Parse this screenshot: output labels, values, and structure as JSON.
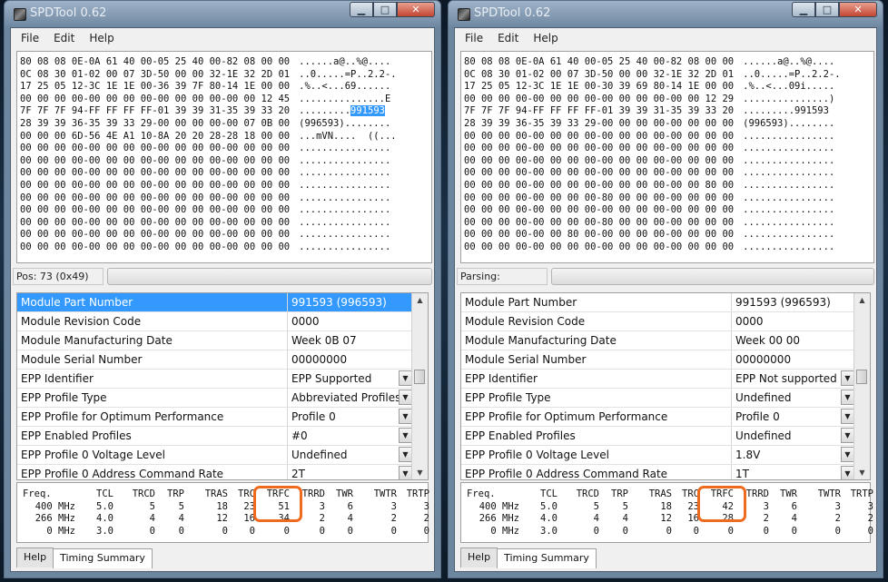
{
  "windows": [
    {
      "title": "SPDTool 0.62",
      "menu": [
        "File",
        "Edit",
        "Help"
      ],
      "hex_lines": [
        {
          "hex": "80 08 08 0E-0A 61 40 00-05 25 40 00-82 08 00 00",
          "ascii": "......a@..%@...."
        },
        {
          "hex": "0C 08 30 01-02 00 07 3D-50 00 00 32-1E 32 2D 01",
          "ascii": "..0.....=P..2.2-."
        },
        {
          "hex": "17 25 05 12-3C 1E 1E 00-36 39 7F 80-14 1E 00 00",
          "ascii": ".%..<...69......"
        },
        {
          "hex": "00 00 00 00-00 00 00 00-00 00 00 00-00 00 12 45",
          "ascii": "...............E"
        },
        {
          "hex": "7F 7F 7F 94-FF FF FF FF-01 39 39 31-35 39 33 20",
          "ascii": ".........",
          "sel": "991593"
        },
        {
          "hex": "28 39 39 36-35 39 33 29-00 00 00 00-00 07 0B 00",
          "ascii": "(996593)........"
        },
        {
          "hex": "00 00 00 6D-56 4E A1 10-8A 20 20 28-28 18 00 00",
          "ascii": "...mVN....  ((..."
        },
        {
          "hex": "00 00 00 00-00 00 00 00-00 00 00 00-00 00 00 00",
          "ascii": "................"
        },
        {
          "hex": "00 00 00 00-00 00 00 00-00 00 00 00-00 00 00 00",
          "ascii": "................"
        },
        {
          "hex": "00 00 00 00-00 00 00 00-00 00 00 00-00 00 00 00",
          "ascii": "................"
        },
        {
          "hex": "00 00 00 00-00 00 00 00-00 00 00 00-00 00 00 00",
          "ascii": "................"
        },
        {
          "hex": "00 00 00 00-00 00 00 00-00 00 00 00-00 00 00 00",
          "ascii": "................"
        },
        {
          "hex": "00 00 00 00-00 00 00 00-00 00 00 00-00 00 00 00",
          "ascii": "................"
        },
        {
          "hex": "00 00 00 00-00 00 00 00-00 00 00 00-00 00 00 00",
          "ascii": "................"
        },
        {
          "hex": "00 00 00 00-00 00 00 00-00 00 00 00-00 00 00 00",
          "ascii": "................"
        },
        {
          "hex": "00 00 00 00-00 00 00 00-00 00 00 00-00 00 00 00",
          "ascii": "................"
        }
      ],
      "status_label": "Pos: 73 (0x49)",
      "properties": [
        {
          "name": "Module Part Number",
          "value": "991593 (996593)",
          "selected": true
        },
        {
          "name": "Module Revision Code",
          "value": "0000"
        },
        {
          "name": "Module Manufacturing Date",
          "value": "Week 0B 07"
        },
        {
          "name": "Module Serial Number",
          "value": "00000000"
        },
        {
          "name": "EPP Identifier",
          "value": "EPP Supported",
          "dropdown": true
        },
        {
          "name": "EPP Profile Type",
          "value": "Abbreviated Profiles",
          "dropdown": true
        },
        {
          "name": "EPP Profile for Optimum Performance",
          "value": "Profile 0",
          "dropdown": true
        },
        {
          "name": "EPP Enabled Profiles",
          "value": "#0",
          "dropdown": true
        },
        {
          "name": "EPP Profile 0 Voltage Level",
          "value": "Undefined",
          "dropdown": true
        },
        {
          "name": "EPP Profile 0 Address Command Rate",
          "value": "2T",
          "dropdown": true
        }
      ],
      "timing": {
        "headers": [
          "Freq.",
          "TCL",
          "TRCD",
          "TRP",
          "TRAS",
          "TRC",
          "TRFC",
          "TRRD",
          "TWR",
          "TWTR",
          "TRTP"
        ],
        "rows": [
          [
            "400 MHz",
            "5.0",
            "5",
            "5",
            "18",
            "23",
            "51",
            "3",
            "6",
            "3",
            "3"
          ],
          [
            "266 MHz",
            "4.0",
            "4",
            "4",
            "12",
            "16",
            "34",
            "2",
            "4",
            "2",
            "2"
          ],
          [
            "0 MHz",
            "3.0",
            "0",
            "0",
            "0",
            "0",
            "0",
            "0",
            "0",
            "0",
            "0"
          ]
        ]
      },
      "tabs": [
        {
          "label": "Help"
        },
        {
          "label": "Timing Summary",
          "active": true
        }
      ]
    },
    {
      "title": "SPDTool 0.62",
      "menu": [
        "File",
        "Edit",
        "Help"
      ],
      "hex_lines": [
        {
          "hex": "80 08 08 0E-0A 61 40 00-05 25 40 00-82 08 00 00",
          "ascii": "......a@..%@...."
        },
        {
          "hex": "0C 08 30 01-02 00 07 3D-50 00 00 32-1E 32 2D 01",
          "ascii": "..0.....=P..2.2-."
        },
        {
          "hex": "17 25 05 12-3C 1E 1E 00-30 39 69 80-14 1E 00 00",
          "ascii": ".%..<...09i....."
        },
        {
          "hex": "00 00 00 00-00 00 00 00-00 00 00 00-00 00 12 29",
          "ascii": "...............)"
        },
        {
          "hex": "7F 7F 7F 94-FF FF FF FF-01 39 39 31-35 39 33 20",
          "ascii": ".........991593 "
        },
        {
          "hex": "28 39 39 36-35 39 33 29-00 00 00 00-00 00 00 00",
          "ascii": "(996593)........"
        },
        {
          "hex": "00 00 00 00-00 00 00 00-00 00 00 00-00 00 00 00",
          "ascii": "................"
        },
        {
          "hex": "00 00 00 00-00 00 00 00-00 00 00 00-00 00 00 00",
          "ascii": "................"
        },
        {
          "hex": "00 00 00 00-00 00 00 00-00 00 00 00-00 00 00 00",
          "ascii": "................"
        },
        {
          "hex": "00 00 00 00-00 00 00 00-00 00 00 00-00 00 00 00",
          "ascii": "................"
        },
        {
          "hex": "00 00 00 00-00 00 00 00-00 00 00 00-00 00 80 00",
          "ascii": "................"
        },
        {
          "hex": "00 00 00 00-00 00 00 00-80 00 00 00-00 00 00 00",
          "ascii": "................"
        },
        {
          "hex": "00 00 00 00-00 00 00 00-00 00 00 00-00 00 00 00",
          "ascii": "................"
        },
        {
          "hex": "00 00 00 00-00 00 00 00-80 00 00 00-00 00 00 00",
          "ascii": "................"
        },
        {
          "hex": "00 00 00 00-00 00 80 00-00 00 00 00-00 00 00 00",
          "ascii": "................"
        },
        {
          "hex": "00 00 00 00-00 00 00 00-00 00 00 00-00 00 00 00",
          "ascii": "................"
        }
      ],
      "status_label": "Parsing:",
      "properties": [
        {
          "name": "Module Part Number",
          "value": "991593 (996593)"
        },
        {
          "name": "Module Revision Code",
          "value": "0000"
        },
        {
          "name": "Module Manufacturing Date",
          "value": "Week 00 00"
        },
        {
          "name": "Module Serial Number",
          "value": "00000000"
        },
        {
          "name": "EPP Identifier",
          "value": "EPP Not supported",
          "dropdown": true
        },
        {
          "name": "EPP Profile Type",
          "value": "Undefined",
          "dropdown": true
        },
        {
          "name": "EPP Profile for Optimum Performance",
          "value": "Profile 0",
          "dropdown": true
        },
        {
          "name": "EPP Enabled Profiles",
          "value": "Undefined",
          "dropdown": true
        },
        {
          "name": "EPP Profile 0 Voltage Level",
          "value": "1.8V",
          "dropdown": true
        },
        {
          "name": "EPP Profile 0 Address Command Rate",
          "value": "1T",
          "dropdown": true
        }
      ],
      "timing": {
        "headers": [
          "Freq.",
          "TCL",
          "TRCD",
          "TRP",
          "TRAS",
          "TRC",
          "TRFC",
          "TRRD",
          "TWR",
          "TWTR",
          "TRTP"
        ],
        "rows": [
          [
            "400 MHz",
            "5.0",
            "5",
            "5",
            "18",
            "23",
            "42",
            "3",
            "6",
            "3",
            "3"
          ],
          [
            "266 MHz",
            "4.0",
            "4",
            "4",
            "12",
            "16",
            "28",
            "2",
            "4",
            "2",
            "2"
          ],
          [
            "0 MHz",
            "3.0",
            "0",
            "0",
            "0",
            "0",
            "0",
            "0",
            "0",
            "0",
            "0"
          ]
        ]
      },
      "tabs": [
        {
          "label": "Help"
        },
        {
          "label": "Timing Summary",
          "active": true
        }
      ]
    }
  ],
  "highlight_color": "#f06a1e",
  "icons": {
    "minimize": "minimize-icon",
    "maximize": "maximize-icon",
    "close": "close-icon",
    "dropdown": "chevron-down-icon"
  }
}
